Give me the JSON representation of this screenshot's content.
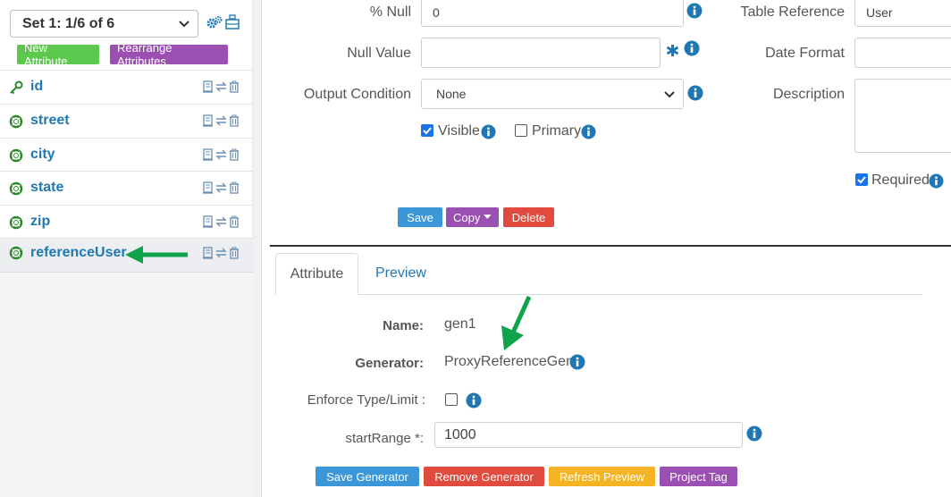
{
  "sidebar": {
    "set_selector": "Set 1: 1/6 of 6",
    "new_attribute": "New Attribute",
    "rearrange_attributes": "Rearrange Attributes",
    "attributes": [
      {
        "name": "id",
        "icon": "key-icon"
      },
      {
        "name": "street",
        "icon": "lifebuoy-icon"
      },
      {
        "name": "city",
        "icon": "lifebuoy-icon"
      },
      {
        "name": "state",
        "icon": "lifebuoy-icon"
      },
      {
        "name": "zip",
        "icon": "lifebuoy-icon"
      },
      {
        "name": "referenceUser",
        "icon": "lifebuoy-icon",
        "selected": true
      }
    ]
  },
  "form": {
    "percent_null_label": "% Null",
    "percent_null_value": "0",
    "null_value_label": "Null Value",
    "null_value_value": "",
    "output_condition_label": "Output Condition",
    "output_condition_value": "None",
    "visible_label": "Visible",
    "visible_checked": true,
    "primary_label": "Primary",
    "primary_checked": false,
    "table_reference_label": "Table Reference",
    "table_reference_value": "User",
    "date_format_label": "Date Format",
    "date_format_value": "",
    "description_label": "Description",
    "description_value": "",
    "required_label": "Required",
    "required_checked": true,
    "save": "Save",
    "copy": "Copy",
    "delete": "Delete"
  },
  "tabs": {
    "attribute": "Attribute",
    "preview": "Preview"
  },
  "generator": {
    "name_label": "Name:",
    "name_value": "gen1",
    "generator_label": "Generator:",
    "generator_value": "ProxyReferenceGen",
    "enforce_label": "Enforce Type/Limit :",
    "enforce_checked": false,
    "start_range_label": "startRange *:",
    "start_range_value": "1000",
    "save_generator": "Save Generator",
    "remove_generator": "Remove Generator",
    "refresh_preview": "Refresh Preview",
    "project_tag": "Project Tag"
  },
  "colors": {
    "link_blue": "#1f78b4",
    "green": "#5cc94e",
    "purple": "#9b4fb3",
    "red": "#e04a3f",
    "orange": "#f5b425",
    "blue_button": "#3b97d8",
    "annotation_arrow": "#0fa34a"
  }
}
